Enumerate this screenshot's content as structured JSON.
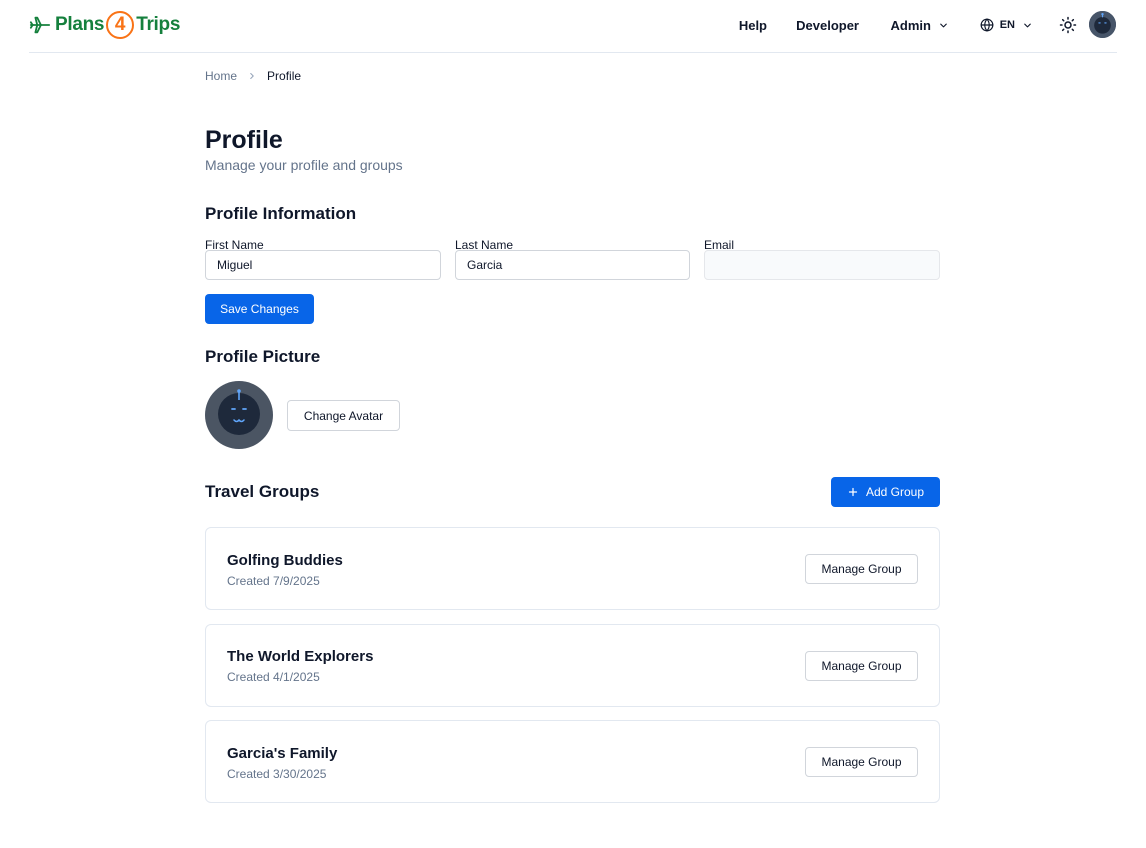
{
  "header": {
    "logo_prefix": "Plans",
    "logo_number": "4",
    "logo_suffix": "Trips",
    "nav": {
      "help": "Help",
      "developer": "Developer",
      "admin": "Admin",
      "language": "EN"
    },
    "icons": {
      "logo": "plane-icon",
      "admin_menu": "chevron-down-icon",
      "language": "globe-icon",
      "language_menu": "chevron-down-icon",
      "theme": "sun-icon",
      "user": "avatar-robot-icon"
    }
  },
  "breadcrumb": {
    "home": "Home",
    "current": "Profile"
  },
  "page": {
    "title": "Profile",
    "subtitle": "Manage your profile and groups"
  },
  "profile_info": {
    "title": "Profile Information",
    "first_name_label": "First Name",
    "first_name_value": "Miguel",
    "last_name_label": "Last Name",
    "last_name_value": "Garcia",
    "email_label": "Email",
    "email_value": "",
    "save_label": "Save Changes"
  },
  "profile_picture": {
    "title": "Profile Picture",
    "change_label": "Change Avatar"
  },
  "travel_groups": {
    "title": "Travel Groups",
    "add_label": "Add Group",
    "manage_label": "Manage Group",
    "groups": [
      {
        "name": "Golfing Buddies",
        "created": "Created 7/9/2025"
      },
      {
        "name": "The World Explorers",
        "created": "Created 4/1/2025"
      },
      {
        "name": "Garcia's Family",
        "created": "Created 3/30/2025"
      }
    ]
  },
  "colors": {
    "brand_green": "#15803d",
    "brand_orange": "#f97316",
    "primary_blue": "#0865e8",
    "border": "#e2e8f0",
    "muted_text": "#64748b"
  }
}
